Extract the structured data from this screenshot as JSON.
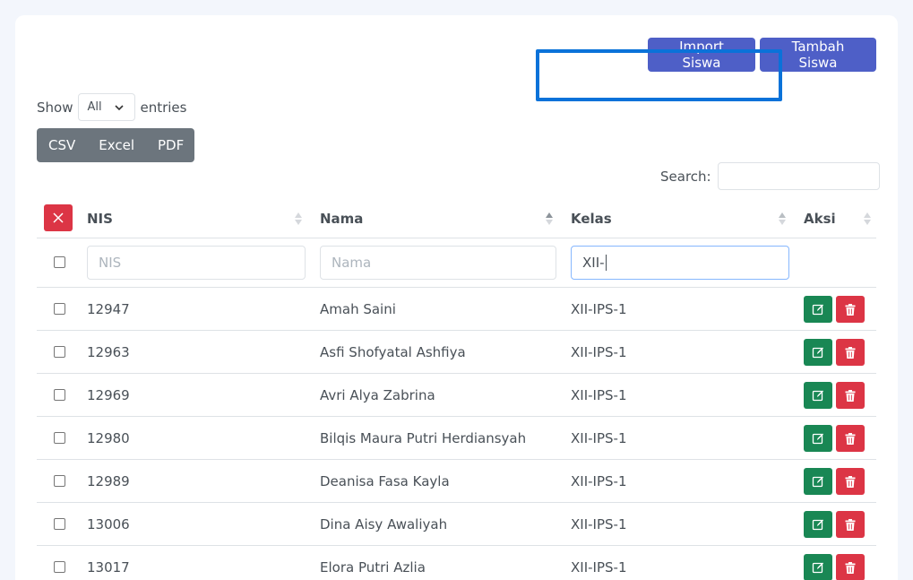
{
  "toolbar": {
    "import_label": "Import Siswa",
    "tambah_label": "Tambah Siswa"
  },
  "length_menu": {
    "show": "Show",
    "selected": "All",
    "entries": "entries"
  },
  "export_buttons": [
    "CSV",
    "Excel",
    "PDF"
  ],
  "search": {
    "label": "Search:",
    "value": ""
  },
  "table": {
    "columns": [
      "NIS",
      "Nama",
      "Kelas",
      "Aksi"
    ],
    "filters": {
      "nis_placeholder": "NIS",
      "nama_placeholder": "Nama",
      "kelas_value": "XII-"
    },
    "rows": [
      {
        "nis": "12947",
        "nama": "Amah Saini",
        "kelas": "XII-IPS-1"
      },
      {
        "nis": "12963",
        "nama": "Asfi Shofyatal Ashfiya",
        "kelas": "XII-IPS-1"
      },
      {
        "nis": "12969",
        "nama": "Avri Alya Zabrina",
        "kelas": "XII-IPS-1"
      },
      {
        "nis": "12980",
        "nama": "Bilqis Maura Putri Herdiansyah",
        "kelas": "XII-IPS-1"
      },
      {
        "nis": "12989",
        "nama": "Deanisa Fasa Kayla",
        "kelas": "XII-IPS-1"
      },
      {
        "nis": "13006",
        "nama": "Dina Aisy Awaliyah",
        "kelas": "XII-IPS-1"
      },
      {
        "nis": "13017",
        "nama": "Elora Putri Azlia",
        "kelas": "XII-IPS-1"
      }
    ]
  },
  "colors": {
    "primary": "#4e5fc7",
    "danger": "#dc3545",
    "success": "#198754",
    "secondary": "#6c757d",
    "highlight": "#0a72d9"
  }
}
